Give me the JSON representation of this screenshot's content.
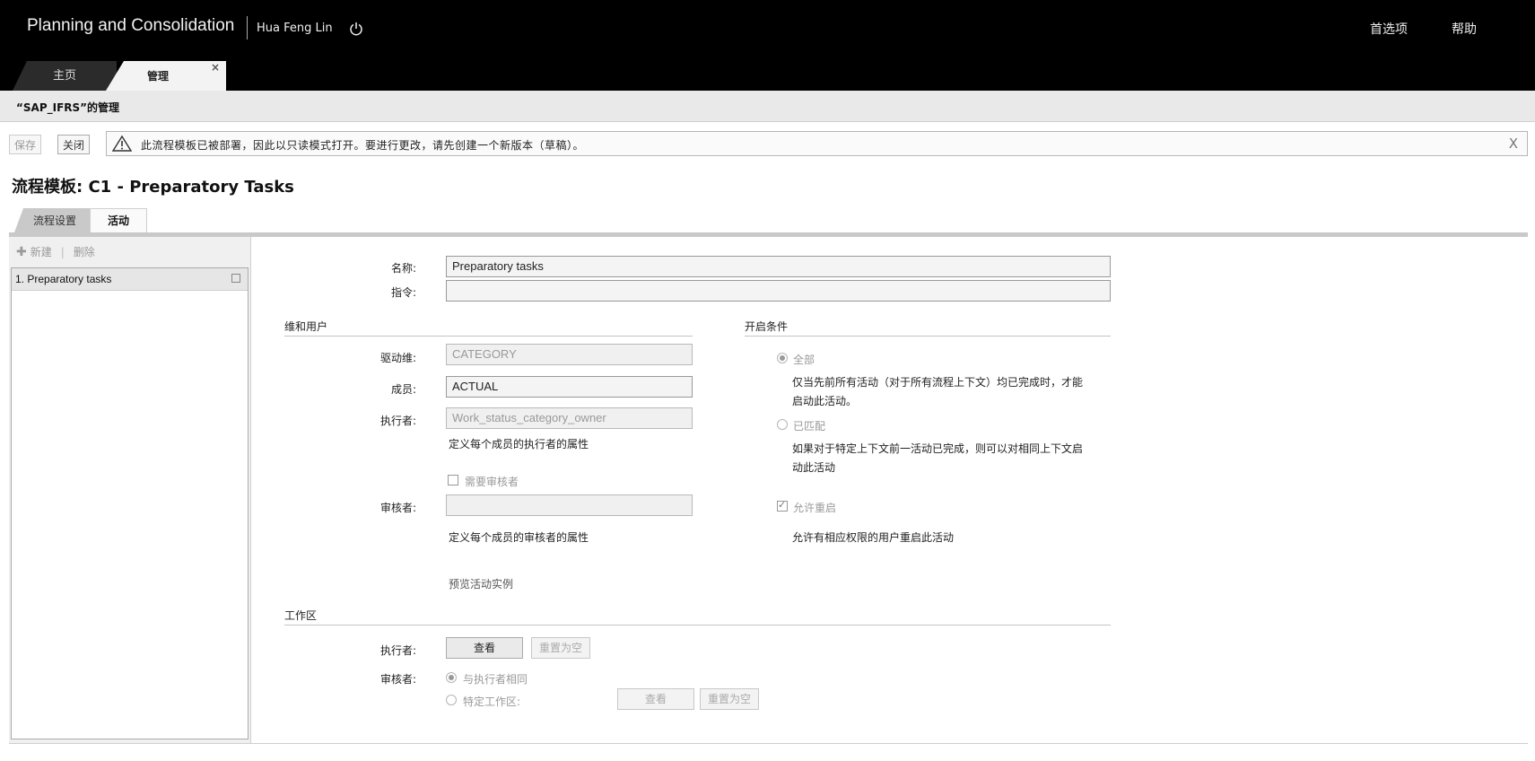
{
  "header": {
    "app_title": "Planning and Consolidation",
    "user_name": "Hua Feng Lin",
    "preferences": "首选项",
    "help": "帮助",
    "tabs": [
      {
        "label": "主页"
      },
      {
        "label": "管理",
        "close": "×"
      }
    ]
  },
  "subheader": {
    "title": "“SAP_IFRS”的管理"
  },
  "toolbar": {
    "save": "保存",
    "close": "关闭"
  },
  "message": {
    "text": "此流程模板已被部署，因此以只读模式打开。要进行更改，请先创建一个新版本（草稿）。",
    "dismiss": "X"
  },
  "page": {
    "title": "流程模板: C1 - Preparatory Tasks"
  },
  "subtabs": [
    {
      "label": "流程设置"
    },
    {
      "label": "活动"
    }
  ],
  "left_panel": {
    "new": "新建",
    "delete": "删除",
    "items": [
      {
        "label": "1.  Preparatory tasks"
      }
    ]
  },
  "form": {
    "name_label": "名称:",
    "name_value": "Preparatory tasks",
    "instruction_label": "指令:",
    "instruction_value": "",
    "dims_section": "维和用户",
    "driver_label": "驱动维:",
    "driver_value": "CATEGORY",
    "member_label": "成员:",
    "member_value": "ACTUAL",
    "performer_label": "执行者:",
    "performer_value": "Work_status_category_owner",
    "performer_hint": "定义每个成员的执行者的属性",
    "require_reviewer": "需要审核者",
    "reviewer_label": "审核者:",
    "reviewer_value": "",
    "reviewer_hint": "定义每个成员的审核者的属性",
    "preview_link": "预览活动实例",
    "open_section": "开启条件",
    "all_label": "全部",
    "all_desc_1": "仅当先前所有活动（对于所有流程上下文）均已完成时，才能",
    "all_desc_2": "启动此活动。",
    "matched_label": "已匹配",
    "matched_desc_1": "如果对于特定上下文前一活动已完成，则可以对相同上下文启",
    "matched_desc_2": "动此活动",
    "allow_reopen": "允许重启",
    "allow_reopen_desc": "允许有相应权限的用户重启此活动",
    "workspace_section": "工作区",
    "ws_performer_label": "执行者:",
    "ws_view": "查看",
    "ws_reset": "重置为空",
    "ws_reviewer_label": "审核者:",
    "ws_same_as_performer": "与执行者相同",
    "ws_specific": "特定工作区:",
    "ws_view2": "查看",
    "ws_reset2": "重置为空"
  }
}
